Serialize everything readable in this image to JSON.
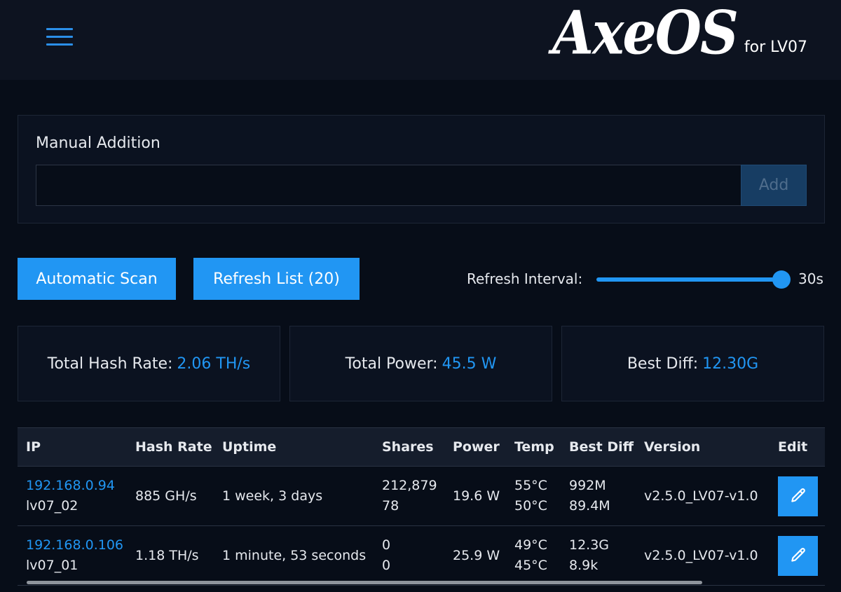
{
  "header": {
    "menu_icon": "hamburger-menu-icon",
    "logo_text": "AxeOS",
    "logo_subtitle": "for LV07"
  },
  "manual": {
    "title": "Manual Addition",
    "input_value": "",
    "add_label": "Add"
  },
  "actions": {
    "scan_label": "Automatic Scan",
    "refresh_label": "Refresh List (20)",
    "interval_label": "Refresh Interval:",
    "interval_value": "30s",
    "interval_level": 1.0
  },
  "stats": {
    "hash_label": "Total Hash Rate:",
    "hash_value": "2.06 TH/s",
    "power_label": "Total Power:",
    "power_value": "45.5 W",
    "diff_label": "Best Diff:",
    "diff_value": "12.30G"
  },
  "table": {
    "headers": [
      "IP",
      "Hash Rate",
      "Uptime",
      "Shares",
      "Power",
      "Temp",
      "Best Diff",
      "Version",
      "Edit"
    ],
    "rows": [
      {
        "ip": "192.168.0.94",
        "hostname": "lv07_02",
        "hash_rate": "885 GH/s",
        "uptime": "1 week, 3 days",
        "shares_accepted": "212,879",
        "shares_rejected": "78",
        "power": "19.6 W",
        "temp_1": "55°C",
        "temp_2": "50°C",
        "best_diff_1": "992M",
        "best_diff_2": "89.4M",
        "version": "v2.5.0_LV07-v1.0",
        "edit_icon": "pencil-icon"
      },
      {
        "ip": "192.168.0.106",
        "hostname": "lv07_01",
        "hash_rate": "1.18 TH/s",
        "uptime": "1 minute, 53 seconds",
        "shares_accepted": "0",
        "shares_rejected": "0",
        "power": "25.9 W",
        "temp_1": "49°C",
        "temp_2": "45°C",
        "best_diff_1": "12.3G",
        "best_diff_2": "8.9k",
        "version": "v2.5.0_LV07-v1.0",
        "edit_icon": "pencil-icon"
      }
    ]
  },
  "colors": {
    "accent": "#2196f3",
    "background": "#070d18",
    "panel": "#0b1220"
  }
}
